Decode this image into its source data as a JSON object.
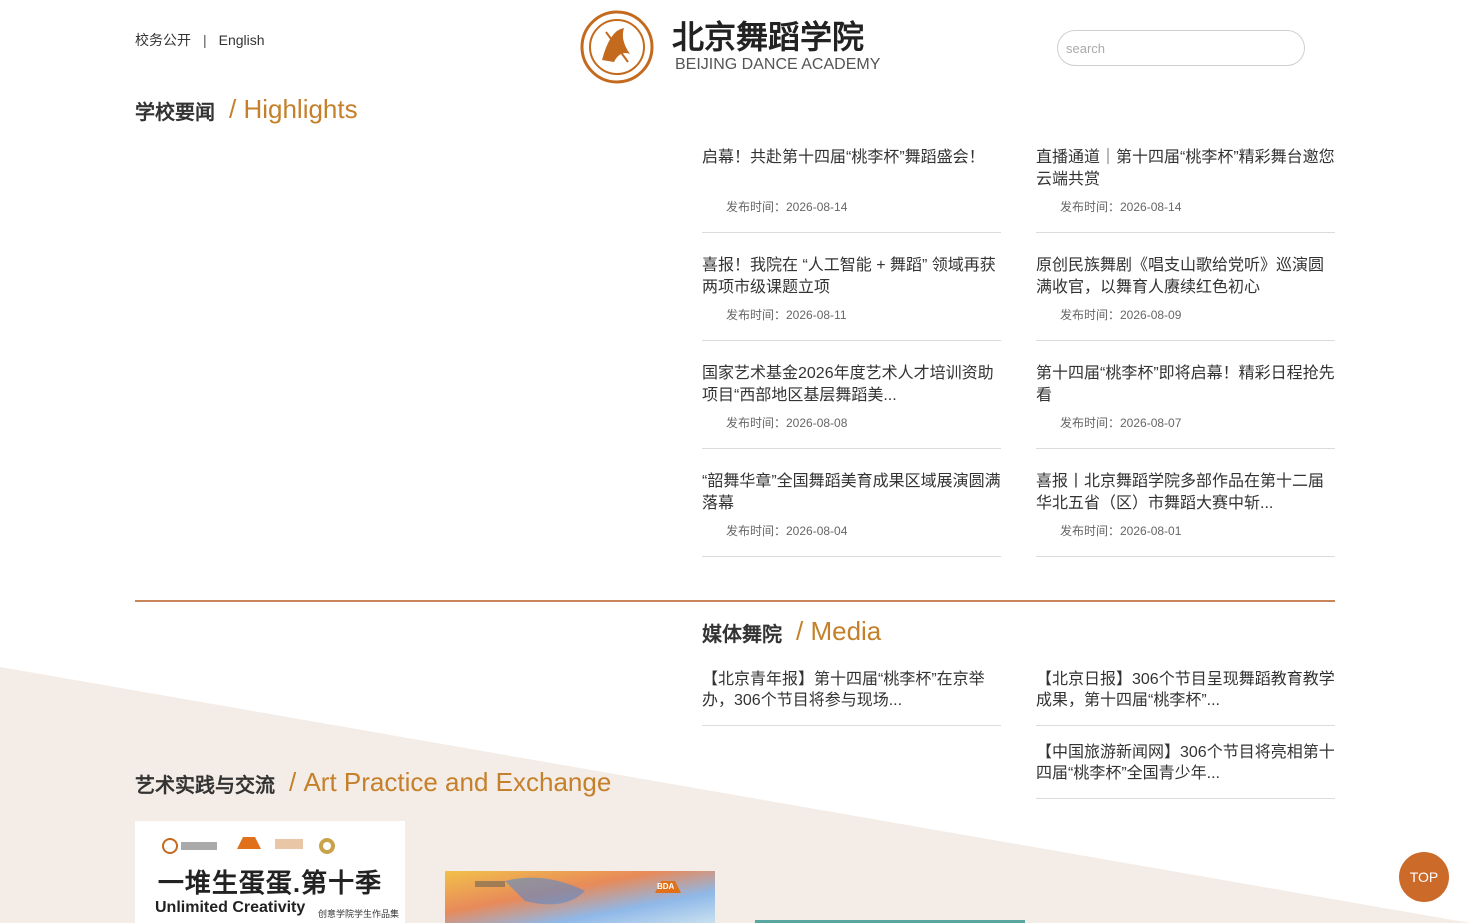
{
  "header": {
    "link_public": "校务公开",
    "separator": "|",
    "link_english": "English",
    "logo_cn": "北京舞蹈学院",
    "logo_en": "BEIJING DANCE ACADEMY",
    "search_placeholder": "search"
  },
  "highlights": {
    "title_cn": "学校要闻",
    "title_en": "/ Highlights",
    "items": [
      {
        "title": "启幕！共赴第十四届“桃李杯”舞蹈盛会！",
        "date": "发布时间：2026-08-14"
      },
      {
        "title": "直播通道｜第十四届“桃李杯”精彩舞台邀您云端共赏",
        "date": "发布时间：2026-08-14"
      },
      {
        "title": "喜报！我院在 “人工智能 + 舞蹈” 领域再获两项市级课题立项",
        "date": "发布时间：2026-08-11"
      },
      {
        "title": "原创民族舞剧《唱支山歌给党听》巡演圆满收官，以舞育人赓续红色初心",
        "date": "发布时间：2026-08-09"
      },
      {
        "title": "国家艺术基金2026年度艺术人才培训资助项目“西部地区基层舞蹈美...",
        "date": "发布时间：2026-08-08"
      },
      {
        "title": "第十四届“桃李杯”即将启幕！精彩日程抢先看",
        "date": "发布时间：2026-08-07"
      },
      {
        "title": "“韶舞华章”全国舞蹈美育成果区域展演圆满落幕",
        "date": "发布时间：2026-08-04"
      },
      {
        "title": "喜报丨北京舞蹈学院多部作品在第十二届华北五省（区）市舞蹈大赛中斩...",
        "date": "发布时间：2026-08-01"
      }
    ]
  },
  "media": {
    "title_cn": "媒体舞院",
    "title_en": "/ Media",
    "items": [
      {
        "title": "【北京青年报】第十四届“桃李杯”在京举办，306个节目将参与现场..."
      },
      {
        "title": "【北京日报】306个节目呈现舞蹈教育教学成果，第十四届“桃李杯”..."
      },
      {
        "title": "【中国旅游新闻网】306个节目将亮相第十四届“桃李杯”全国青少年..."
      }
    ]
  },
  "art": {
    "title_cn": "艺术实践与交流",
    "title_en": "/ Art Practice and Exchange",
    "card1_title": "一堆生蛋蛋.第十季",
    "card1_sub": "Unlimited Creativity",
    "card1_sub2": "创意学院学生作品集",
    "card2_badge": "BDA"
  },
  "top_button": "TOP",
  "colors": {
    "accent": "#c4802a",
    "divider": "#c8845a",
    "top_button": "#cc6a2a",
    "background_shape": "#f4ece6"
  }
}
